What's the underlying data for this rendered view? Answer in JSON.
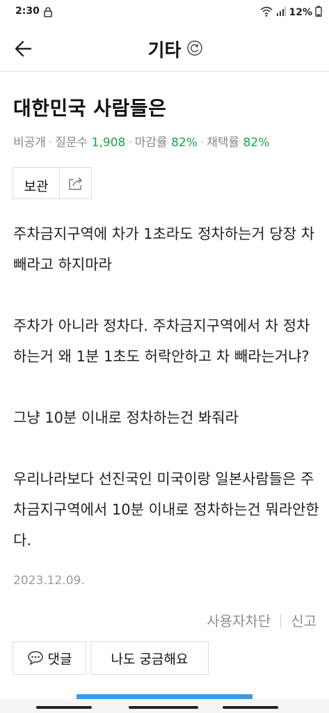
{
  "status_bar": {
    "time": "2:30",
    "battery": "12%"
  },
  "header": {
    "title": "기타"
  },
  "question": {
    "title": "대한민국 사람들은",
    "meta": {
      "visibility": "비공개",
      "questions_label": "질문수",
      "questions_value": "1,908",
      "deadline_label": "마감률",
      "deadline_value": "82%",
      "adopt_label": "채택률",
      "adopt_value": "82%"
    },
    "save_label": "보관",
    "paragraphs": [
      "주차금지구역에 차가 1초라도 정차하는거 당장 차빼라고 하지마라",
      "주차가 아니라 정차다. 주차금지구역에서 차 정차하는거 왜 1분 1초도 허락안하고 차 빼라는거냐?",
      "그냥 10분 이내로 정차하는건 봐줘라",
      "우리나라보다 선진국인 미국이랑 일본사람들은 주차금지구역에서 10분 이내로 정차하는건 뭐라안한다."
    ],
    "date": "2023.12.09."
  },
  "user_actions": {
    "block_label": "사용자차단",
    "report_label": "신고"
  },
  "bottom": {
    "comment_label": "댓글",
    "curious_label": "나도 궁금해요"
  },
  "colors": {
    "accent_green": "#19a34b",
    "scroll_blue": "#3a9ae8"
  }
}
